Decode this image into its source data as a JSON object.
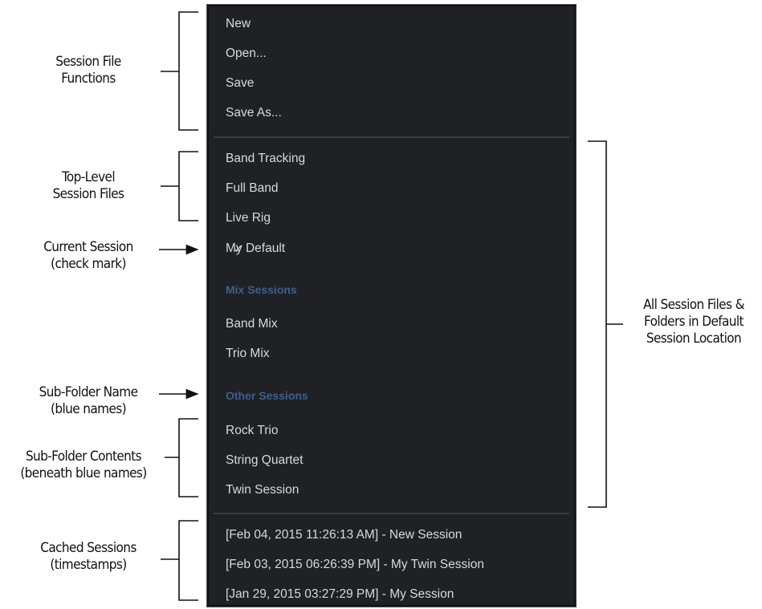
{
  "menu": {
    "file_functions": [
      "New",
      "Open...",
      "Save",
      "Save As..."
    ],
    "top_level_sessions": [
      "Band Tracking",
      "Full Band",
      "Live Rig"
    ],
    "current_session": {
      "check": "✓",
      "label": "My Default"
    },
    "folders": [
      {
        "name": "Mix Sessions",
        "items": [
          "Band Mix",
          "Trio Mix"
        ]
      },
      {
        "name": "Other Sessions",
        "items": [
          "Rock Trio",
          "String Quartet",
          "Twin Session"
        ]
      }
    ],
    "cached_sessions": [
      "[Feb 04, 2015 11:26:13 AM] - New Session",
      "[Feb 03, 2015 06:26:39 PM] - My Twin Session",
      "[Jan 29, 2015 03:27:29 PM] - My Session"
    ],
    "folder_name_color": "#3f5f8f",
    "menu_bg_color": "#1f2124"
  },
  "annotations": {
    "session_file_functions": "Session File\nFunctions",
    "top_level_session_files": "Top-Level\nSession Files",
    "current_session": "Current Session\n(check mark)",
    "sub_folder_name": "Sub-Folder Name\n(blue names)",
    "sub_folder_contents": "Sub-Folder Contents\n(beneath blue names)",
    "cached_sessions": "Cached Sessions\n(timestamps)",
    "all_session_files": "All Session Files &\nFolders in Default\nSession Location"
  }
}
